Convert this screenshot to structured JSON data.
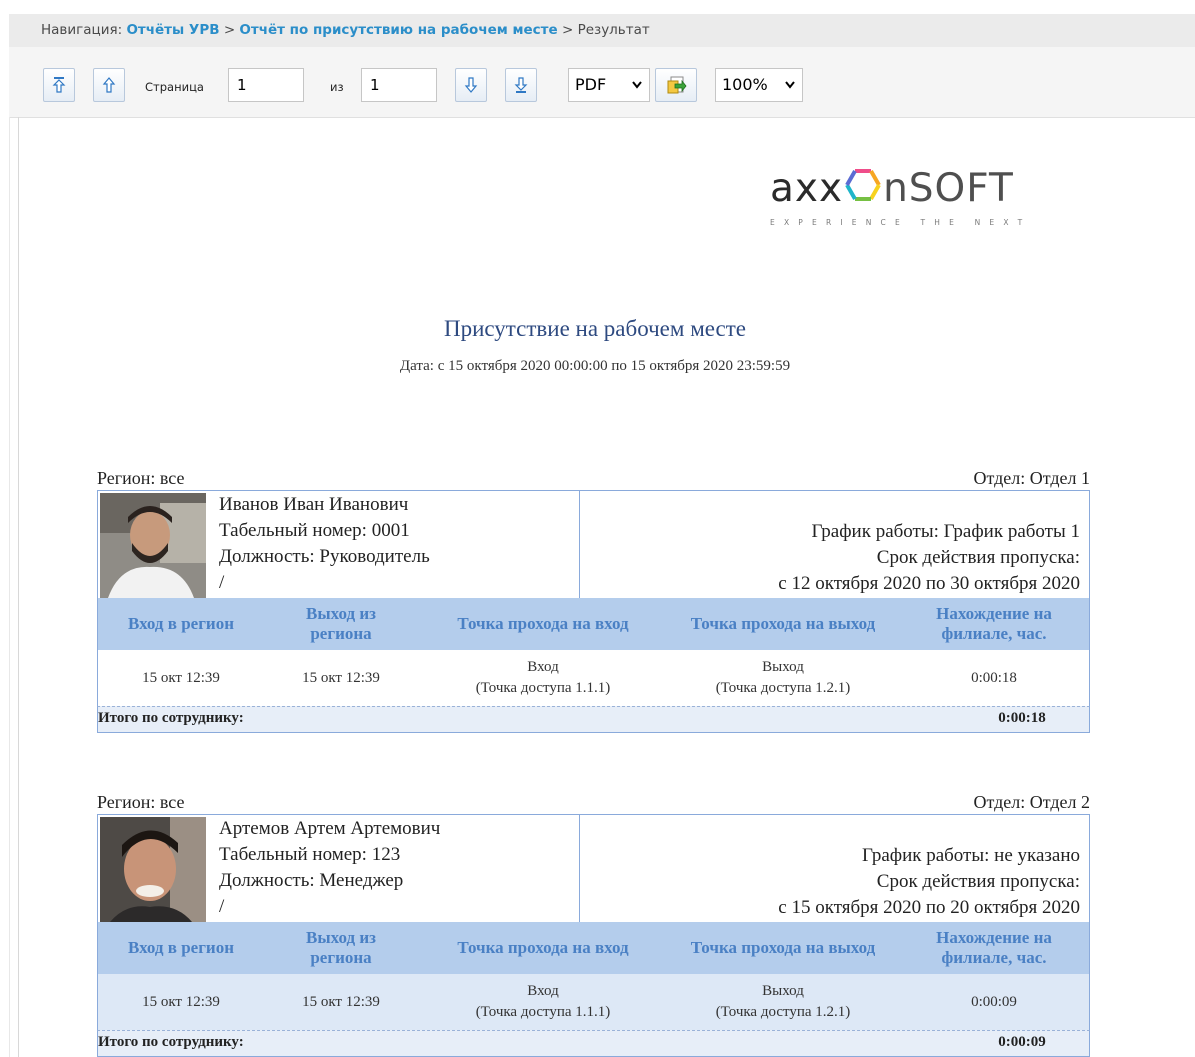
{
  "nav": {
    "prefix": "Навигация:",
    "link1": "Отчёты УРВ",
    "sep": ">",
    "link2": "Отчёт по присутствию на рабочем месте",
    "current": "Результат"
  },
  "toolbar": {
    "page_label": "Страница",
    "page_value": "1",
    "of_label": "из",
    "total_pages": "1",
    "format": "PDF",
    "zoom": "100%"
  },
  "logo": {
    "word_a": "axx",
    "word_b": "nSOFT",
    "tagline": "EXPERIENCE THE NEXT"
  },
  "report": {
    "title": "Присутствие на рабочем месте",
    "date": "Дата: с 15 октября 2020 00:00:00 по 15 октября 2020 23:59:59",
    "columns": [
      "Вход в регион",
      "Выход из региона",
      "Точка прохода на вход",
      "Точка прохода на выход",
      "Нахождение на филиале, час."
    ],
    "total_label": "Итого по сотруднику:",
    "employees": [
      {
        "region": "Регион: все",
        "dept": "Отдел: Отдел 1",
        "name": "Иванов Иван Иванович",
        "tab_no": "Табельный номер: 0001",
        "position": "Должность: Руководитель",
        "slash": "/",
        "schedule": "График работы: График работы 1",
        "pass_label": "Срок действия пропуска:",
        "pass_period": "с 12 октября 2020 по 30 октября 2020",
        "row": {
          "in": "15 окт 12:39",
          "out": "15 окт 12:39",
          "entry_point": "Вход",
          "entry_device": "(Точка доступа 1.1.1)",
          "exit_point": "Выход",
          "exit_device": "(Точка доступа 1.2.1)",
          "duration": "0:00:18"
        },
        "total": "0:00:18"
      },
      {
        "region": "Регион: все",
        "dept": "Отдел: Отдел 2",
        "name": "Артемов Артем Артемович",
        "tab_no": "Табельный номер: 123",
        "position": "Должность: Менеджер",
        "slash": "/",
        "schedule": "График работы: не указано",
        "pass_label": "Срок действия пропуска:",
        "pass_period": "с 15 октября 2020 по 20 октября 2020",
        "row": {
          "in": "15 окт 12:39",
          "out": "15 окт 12:39",
          "entry_point": "Вход",
          "entry_device": "(Точка доступа 1.1.1)",
          "exit_point": "Выход",
          "exit_device": "(Точка доступа 1.2.1)",
          "duration": "0:00:09"
        },
        "total": "0:00:09"
      }
    ]
  }
}
